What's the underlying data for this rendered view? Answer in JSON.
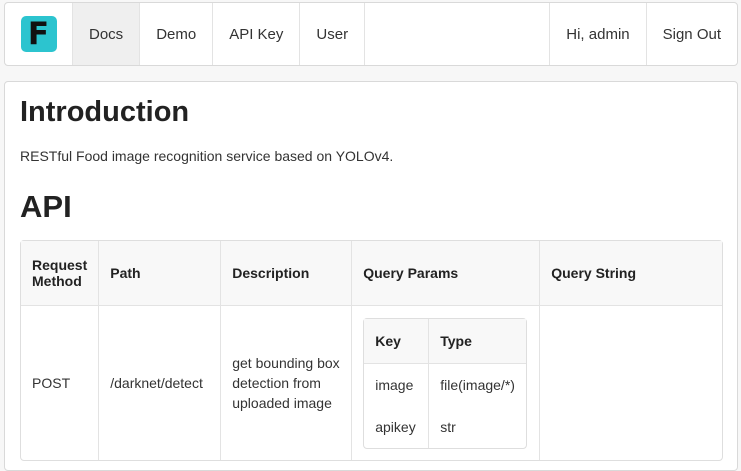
{
  "navbar": {
    "logo_letter": "F",
    "logo_color": "#2cc4cf",
    "items": [
      {
        "label": "Docs",
        "active": true
      },
      {
        "label": "Demo"
      },
      {
        "label": "API Key"
      },
      {
        "label": "User"
      }
    ],
    "greeting": "Hi, admin",
    "signout": "Sign Out"
  },
  "intro": {
    "heading": "Introduction",
    "text": "RESTful Food image recognition service based on YOLOv4."
  },
  "api": {
    "heading": "API",
    "columns": [
      "Request Method",
      "Path",
      "Description",
      "Query Params",
      "Query String"
    ],
    "rows": [
      {
        "method": "POST",
        "path": "/darknet/detect",
        "description": "get bounding box detection from uploaded image",
        "params": {
          "columns": [
            "Key",
            "Type"
          ],
          "rows": [
            [
              "image",
              "file(image/*)"
            ],
            [
              "apikey",
              "str"
            ]
          ]
        },
        "query_string": ""
      }
    ]
  }
}
